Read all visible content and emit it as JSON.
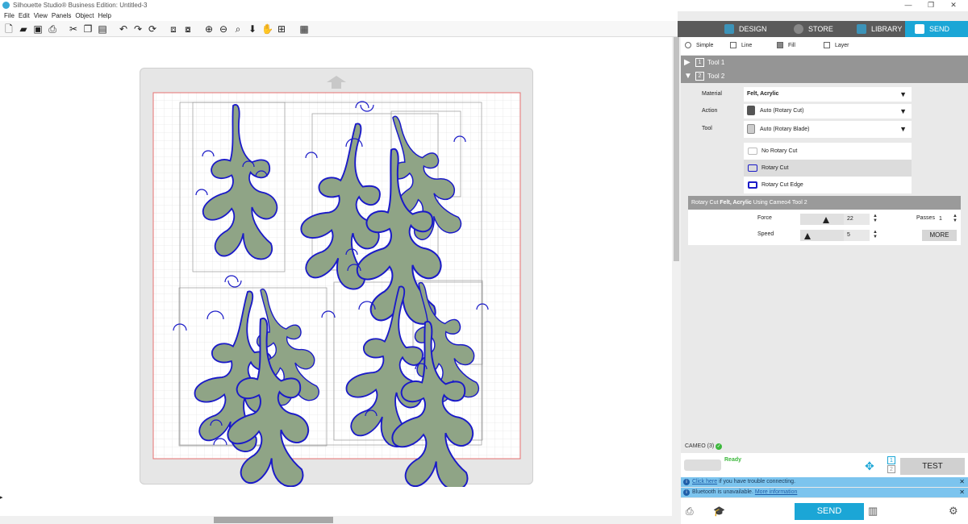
{
  "window": {
    "title": "Silhouette Studio® Business Edition: Untitled-3",
    "min": "—",
    "restore": "❐",
    "close": "✕"
  },
  "menu": [
    "File",
    "Edit",
    "View",
    "Panels",
    "Object",
    "Help"
  ],
  "nav": {
    "tabs": [
      {
        "label": "DESIGN",
        "color": "#3c93b8"
      },
      {
        "label": "STORE",
        "color": "#888"
      },
      {
        "label": "LIBRARY",
        "color": "#3c93b8"
      },
      {
        "label": "SEND",
        "color": "#fff"
      }
    ],
    "active": "SEND",
    "accent": "#1ba6d6"
  },
  "toolbar_icons": [
    "new-icon",
    "open-icon",
    "save-icon",
    "print-icon",
    "cut-icon",
    "copy-icon",
    "paste-icon",
    "undo-icon",
    "redo-icon",
    "refresh-icon",
    "group-icon",
    "ungroup-icon",
    "zoom-in-icon",
    "zoom-out-icon",
    "zoom-select-icon",
    "pan-down-icon",
    "hand-icon",
    "fit-icon",
    "grid-icon"
  ],
  "modes": {
    "simple": "Simple",
    "line": "Line",
    "fill": "Fill",
    "layer": "Layer"
  },
  "tools": [
    {
      "num": "1",
      "label": "Tool 1"
    },
    {
      "num": "2",
      "label": "Tool 2"
    }
  ],
  "settings": {
    "material_label": "Material",
    "material": "Felt, Acrylic",
    "action_label": "Action",
    "action": "Auto (Rotary Cut)",
    "tool_label": "Tool",
    "tool": "Auto (Rotary Blade)",
    "options": [
      "No Rotary Cut",
      "Rotary Cut",
      "Rotary Cut Edge"
    ],
    "selected_option": "Rotary Cut"
  },
  "rotary": {
    "header_prefix": "Rotary Cut ",
    "header_bold": "Felt, Acrylic",
    "header_suffix": " Using Cameo4 Tool 2",
    "force_label": "Force",
    "force": "22",
    "force_fraction": 0.6,
    "speed_label": "Speed",
    "speed": "5",
    "speed_fraction": 0.17,
    "passes_label": "Passes",
    "passes": "1",
    "more": "MORE"
  },
  "device": {
    "name": "CAMEO (3)",
    "status": "Ready",
    "status_color": "#3cb83c",
    "test": "TEST"
  },
  "notices": [
    {
      "link": "Click here",
      "text": " if you have trouble connecting."
    },
    {
      "text": "Bluetooth is unavailable. ",
      "link": "More information"
    }
  ],
  "send_label": "SEND"
}
